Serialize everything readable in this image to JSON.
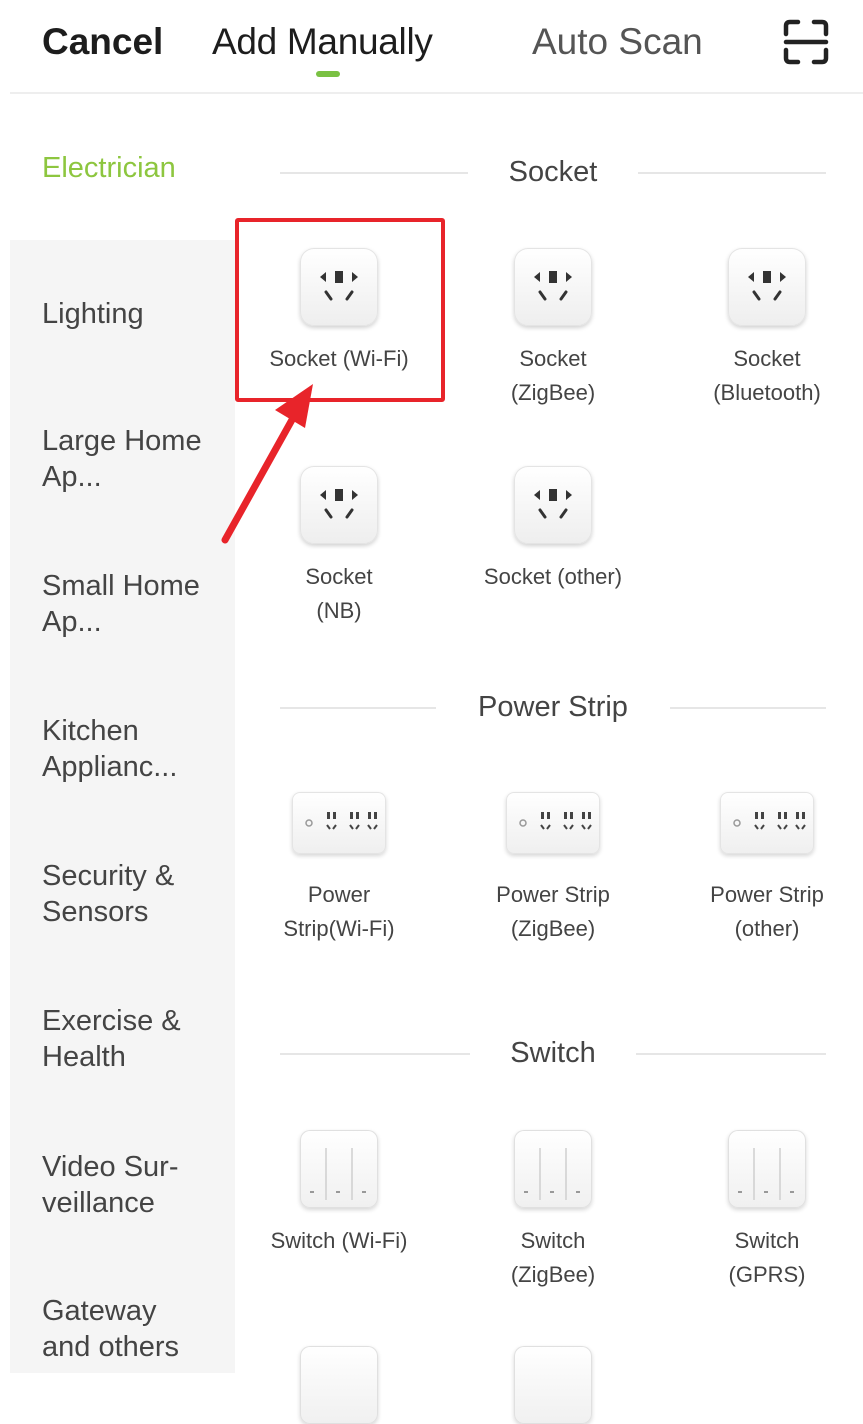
{
  "header": {
    "cancel_label": "Cancel",
    "tabs": [
      {
        "label": "Add Manually",
        "active": true
      },
      {
        "label": "Auto Scan",
        "active": false
      }
    ],
    "scan_icon": "scan-icon",
    "accent_color": "#7ac143"
  },
  "sidebar": {
    "items": [
      {
        "label": "Electrician",
        "active": true
      },
      {
        "label": "Lighting"
      },
      {
        "label": "Large Home Ap..."
      },
      {
        "label": "Small Home Ap..."
      },
      {
        "label": "Kitchen Applianc..."
      },
      {
        "label": "Security & Sensors"
      },
      {
        "label": "Exercise & Health"
      },
      {
        "label": "Video Sur-veillance"
      },
      {
        "label": "Gateway and others"
      }
    ]
  },
  "sections": [
    {
      "title": "Socket",
      "devices": [
        {
          "label": "Socket (Wi-Fi)",
          "icon": "socket-icon",
          "highlighted": true
        },
        {
          "label": "Socket (ZigBee)",
          "icon": "socket-icon"
        },
        {
          "label": "Socket (Bluetooth)",
          "icon": "socket-icon"
        },
        {
          "label": "Socket (NB)",
          "icon": "socket-icon"
        },
        {
          "label": "Socket (other)",
          "icon": "socket-icon"
        }
      ]
    },
    {
      "title": "Power Strip",
      "devices": [
        {
          "label": "Power Strip(Wi-Fi)",
          "icon": "power-strip-icon"
        },
        {
          "label": "Power Strip (ZigBee)",
          "icon": "power-strip-icon"
        },
        {
          "label": "Power Strip (other)",
          "icon": "power-strip-icon"
        }
      ]
    },
    {
      "title": "Switch",
      "devices": [
        {
          "label": "Switch (Wi-Fi)",
          "icon": "switch-icon"
        },
        {
          "label": "Switch (ZigBee)",
          "icon": "switch-icon"
        },
        {
          "label": "Switch (GPRS)",
          "icon": "switch-icon"
        }
      ]
    }
  ],
  "annotation": {
    "highlight_color": "#e8242a"
  }
}
